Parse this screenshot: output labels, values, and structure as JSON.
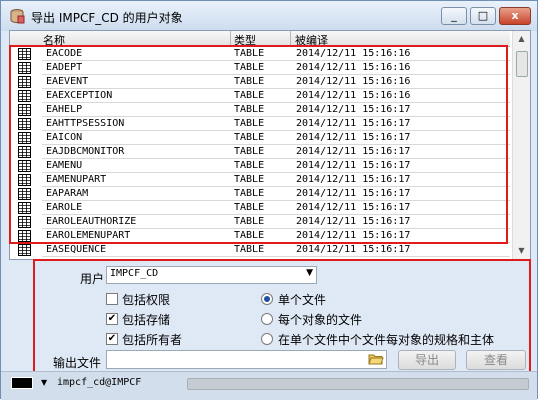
{
  "window": {
    "title": "导出 IMPCF_CD 的用户对象",
    "controls": [
      "_",
      "□",
      "x"
    ]
  },
  "table": {
    "columns": [
      "名称",
      "类型",
      "被编译"
    ],
    "rows": [
      {
        "name": "EACODE",
        "type": "TABLE",
        "compiled": "2014/12/11 15:16:16"
      },
      {
        "name": "EADEPT",
        "type": "TABLE",
        "compiled": "2014/12/11 15:16:16"
      },
      {
        "name": "EAEVENT",
        "type": "TABLE",
        "compiled": "2014/12/11 15:16:16"
      },
      {
        "name": "EAEXCEPTION",
        "type": "TABLE",
        "compiled": "2014/12/11 15:16:16"
      },
      {
        "name": "EAHELP",
        "type": "TABLE",
        "compiled": "2014/12/11 15:16:17"
      },
      {
        "name": "EAHTTPSESSION",
        "type": "TABLE",
        "compiled": "2014/12/11 15:16:17"
      },
      {
        "name": "EAICON",
        "type": "TABLE",
        "compiled": "2014/12/11 15:16:17"
      },
      {
        "name": "EAJDBCMONITOR",
        "type": "TABLE",
        "compiled": "2014/12/11 15:16:17"
      },
      {
        "name": "EAMENU",
        "type": "TABLE",
        "compiled": "2014/12/11 15:16:17"
      },
      {
        "name": "EAMENUPART",
        "type": "TABLE",
        "compiled": "2014/12/11 15:16:17"
      },
      {
        "name": "EAPARAM",
        "type": "TABLE",
        "compiled": "2014/12/11 15:16:17"
      },
      {
        "name": "EAROLE",
        "type": "TABLE",
        "compiled": "2014/12/11 15:16:17"
      },
      {
        "name": "EAROLEAUTHORIZE",
        "type": "TABLE",
        "compiled": "2014/12/11 15:16:17"
      },
      {
        "name": "EAROLEMENUPART",
        "type": "TABLE",
        "compiled": "2014/12/11 15:16:17"
      },
      {
        "name": "EASEQUENCE",
        "type": "TABLE",
        "compiled": "2014/12/11 15:16:17"
      }
    ]
  },
  "options": {
    "user_label": "用户",
    "user_value": "IMPCF_CD",
    "include_privileges": {
      "label": "包括权限",
      "checked": false
    },
    "include_storage": {
      "label": "包括存储",
      "checked": true
    },
    "include_owner": {
      "label": "包括所有者",
      "checked": true
    },
    "radio_single_file": {
      "label": "单个文件",
      "selected": true
    },
    "radio_per_object": {
      "label": "每个对象的文件",
      "selected": false
    },
    "radio_spec_body": {
      "label": "在单个文件中个文件每对象的规格和主体",
      "selected": false
    },
    "output_label": "输出文件",
    "output_value": "",
    "export_button": "导出",
    "view_button": "查看"
  },
  "status": {
    "connection": "impcf_cd@IMPCF"
  },
  "colors": {
    "highlight": "#e01b1b",
    "radio_dot": "#1f4fa3"
  }
}
